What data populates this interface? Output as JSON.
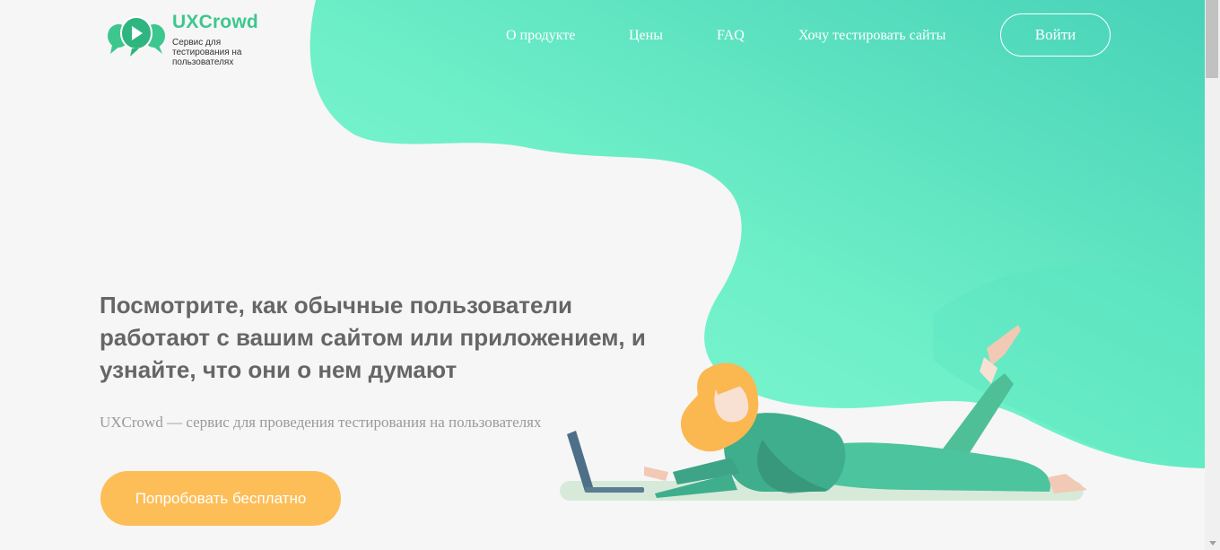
{
  "colors": {
    "accent_green": "#3dc78f",
    "wave_light": "#7cf5d1",
    "wave_dark": "#4ed6b8",
    "cta": "#fdbe58",
    "background": "#f6f6f6"
  },
  "logo": {
    "name": "UXCrowd",
    "tagline": "Сервис для тестирования на пользователях",
    "icon": "chat-bubbles-play-icon"
  },
  "nav": {
    "items": [
      {
        "label": "О продукте"
      },
      {
        "label": "Цены"
      },
      {
        "label": "FAQ"
      },
      {
        "label": "Хочу тестировать сайты"
      }
    ],
    "login_label": "Войти"
  },
  "hero": {
    "title": "Посмотрите, как обычные пользователи работают с вашим сайтом или приложением, и узнайте, что они о нем думают",
    "subtitle": "UXCrowd — сервис для проведения тестирования на пользователях",
    "cta_label": "Попробовать бесплатно"
  }
}
